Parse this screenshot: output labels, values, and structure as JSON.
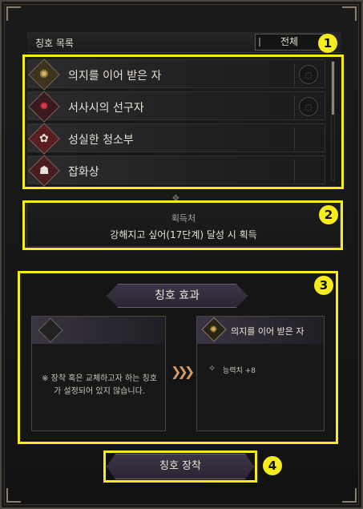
{
  "title_list": {
    "header": "칭호 목록",
    "filter": "전체",
    "rows": [
      {
        "label": "의지를 이어 받은 자",
        "icon": "sun-emblem-icon",
        "icon_char": "✺",
        "icon_color": "#d8b660",
        "frame": "#3d3420"
      },
      {
        "label": "서사시의 선구자",
        "icon": "red-emblem-icon",
        "icon_char": "✹",
        "icon_color": "#d9374a",
        "frame": "#3b1a1e"
      },
      {
        "label": "성실한 청소부",
        "icon": "seal-emblem-icon",
        "icon_char": "✿",
        "icon_color": "#e8e4dc",
        "frame": "#5a1e22"
      },
      {
        "label": "잡화상",
        "icon": "merchant-emblem-icon",
        "icon_char": "☗",
        "icon_color": "#e8e4dc",
        "frame": "#4a1c20"
      }
    ]
  },
  "source": {
    "title": "획득처",
    "description": "강해지고 싶어(17단계) 달성 시 획득"
  },
  "effect": {
    "tab_label": "칭호 효과",
    "empty_message": "※ 장착 혹은 교체하고자 하는 칭호가 설정되어 있지 않습니다.",
    "selected_name": "의지를 이어 받은 자",
    "stat": "능력치 +8"
  },
  "equip_label": "칭호 장착",
  "markers": [
    "1",
    "2",
    "3",
    "4"
  ],
  "colors": {
    "highlight": "#f5ec1a",
    "accent_purple": "#3d3547"
  }
}
